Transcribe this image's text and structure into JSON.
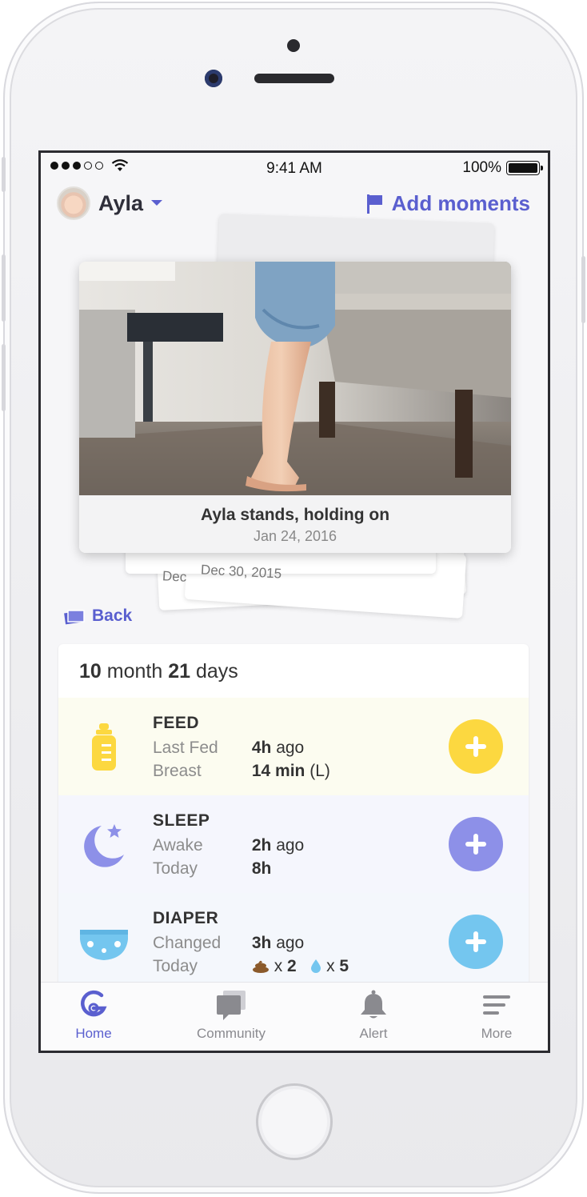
{
  "status_bar": {
    "time": "9:41 AM",
    "battery": "100%"
  },
  "header": {
    "child_name": "Ayla",
    "add_moments": "Add moments"
  },
  "moment": {
    "title": "Ayla stands, holding on",
    "date": "Jan 24, 2016",
    "stack_dates": [
      "Dec",
      "Dec 30, 2015"
    ]
  },
  "back_label": "Back",
  "age": {
    "months": "10",
    "month_word": "month",
    "days": "21",
    "day_word": "days"
  },
  "activities": {
    "feed": {
      "title": "FEED",
      "line1_label": "Last Fed",
      "line1_value_bold": "4h",
      "line1_value_rest": "ago",
      "line2_label": "Breast",
      "line2_value_bold": "14 min",
      "line2_value_rest": "(L)",
      "color": "#fcd840"
    },
    "sleep": {
      "title": "SLEEP",
      "line1_label": "Awake",
      "line1_value_bold": "2h",
      "line1_value_rest": "ago",
      "line2_label": "Today",
      "line2_value_bold": "8h",
      "color": "#8d90e8"
    },
    "diaper": {
      "title": "DIAPER",
      "line1_label": "Changed",
      "line1_value_bold": "3h",
      "line1_value_rest": "ago",
      "line2_label": "Today",
      "poop_x": "x",
      "poop_count": "2",
      "wet_x": "x",
      "wet_count": "5",
      "color": "#74c6ef"
    }
  },
  "tabs": [
    {
      "label": "Home",
      "icon": "home-g-icon",
      "active": true
    },
    {
      "label": "Community",
      "icon": "chat-bubbles-icon",
      "active": false
    },
    {
      "label": "Alert",
      "icon": "bell-icon",
      "active": false
    },
    {
      "label": "More",
      "icon": "menu-lines-icon",
      "active": false
    }
  ],
  "colors": {
    "accent": "#5a5fcf",
    "feed": "#fcd840",
    "sleep": "#8d90e8",
    "diaper": "#74c6ef"
  }
}
